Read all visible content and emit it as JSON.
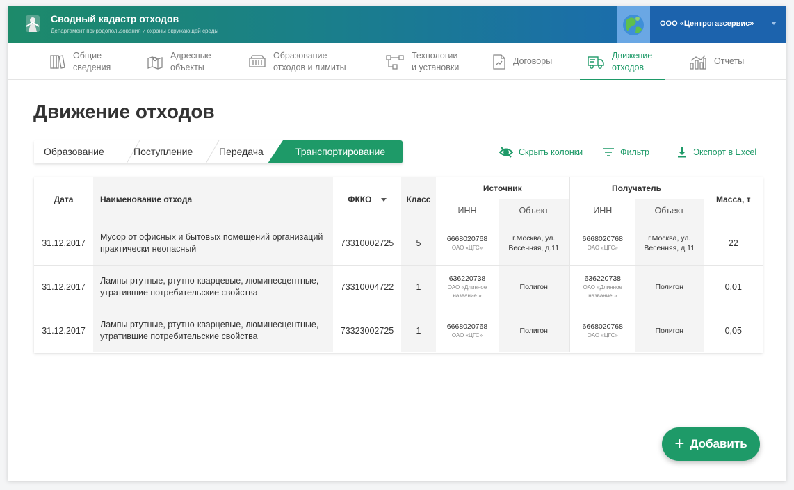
{
  "header": {
    "title": "Сводный кадастр отходов",
    "subtitle": "Департамент природопользования и охраны окружающей среды",
    "org_name": "ООО «Центрогазсервис»",
    "gradient_colors": [
      "#1d8a6a",
      "#1e68b8"
    ]
  },
  "nav": [
    {
      "label1": "Общие",
      "label2": "сведения",
      "icon": "books-icon"
    },
    {
      "label1": "Адресные",
      "label2": "объекты",
      "icon": "map-icon"
    },
    {
      "label1": "Образование",
      "label2": "отходов и лимиты",
      "icon": "container-icon"
    },
    {
      "label1": "Технологии",
      "label2": "и установки",
      "icon": "flow-icon"
    },
    {
      "label1": "Договоры",
      "label2": "",
      "icon": "document-icon"
    },
    {
      "label1": "Движение",
      "label2": "отходов",
      "icon": "truck-icon",
      "active": true
    },
    {
      "label1": "Отчеты",
      "label2": "",
      "icon": "bar-chart-icon"
    }
  ],
  "page": {
    "title": "Движение отходов",
    "accent": "#1e9a68"
  },
  "tabs": [
    "Образование",
    "Поступление",
    "Передача",
    "Транспортирование"
  ],
  "active_tab": "Транспортирование",
  "actions": {
    "hide_columns": "Скрыть колонки",
    "filter": "Фильтр",
    "export": "Экспорт в Excel"
  },
  "table": {
    "headers": {
      "date": "Дата",
      "name": "Наименование отхода",
      "fkko": "ФККО",
      "class": "Класс",
      "source": "Источник",
      "receiver": "Получатель",
      "inn": "ИНН",
      "object": "Объект",
      "mass": "Масса, т"
    },
    "rows": [
      {
        "date": "31.12.2017",
        "name": "Мусор от офисных и бытовых помещений организаций практически неопасный",
        "fkko": "73310002725",
        "class": "5",
        "src_inn": "6668020768",
        "src_org": "ОАО «ЦГС»",
        "src_obj": "г.Москва, ул. Весенняя, д.11",
        "rcv_inn": "6668020768",
        "rcv_org": "ОАО «ЦГС»",
        "rcv_obj": "г.Москва, ул. Весенняя, д.11",
        "mass": "22"
      },
      {
        "date": "31.12.2017",
        "name": "Лампы ртутные, ртутно-кварцевые, люминесцентные, утратившие потребительские свойства",
        "fkko": "73310004722",
        "class": "1",
        "src_inn": "636220738",
        "src_org": "ОАО «Длинное название »",
        "src_obj": "Полигон",
        "rcv_inn": "636220738",
        "rcv_org": "ОАО «Длинное название »",
        "rcv_obj": "Полигон",
        "mass": "0,01"
      },
      {
        "date": "31.12.2017",
        "name": "Лампы ртутные, ртутно-кварцевые, люминесцентные, утратившие потребительские свойства",
        "fkko": "73323002725",
        "class": "1",
        "src_inn": "6668020768",
        "src_org": "ОАО «ЦГС»",
        "src_obj": "Полигон",
        "rcv_inn": "6668020768",
        "rcv_org": "ОАО «ЦГС»",
        "rcv_obj": "Полигон",
        "mass": "0,05"
      }
    ]
  },
  "fab": {
    "label": "Добавить",
    "icon": "plus-icon"
  }
}
